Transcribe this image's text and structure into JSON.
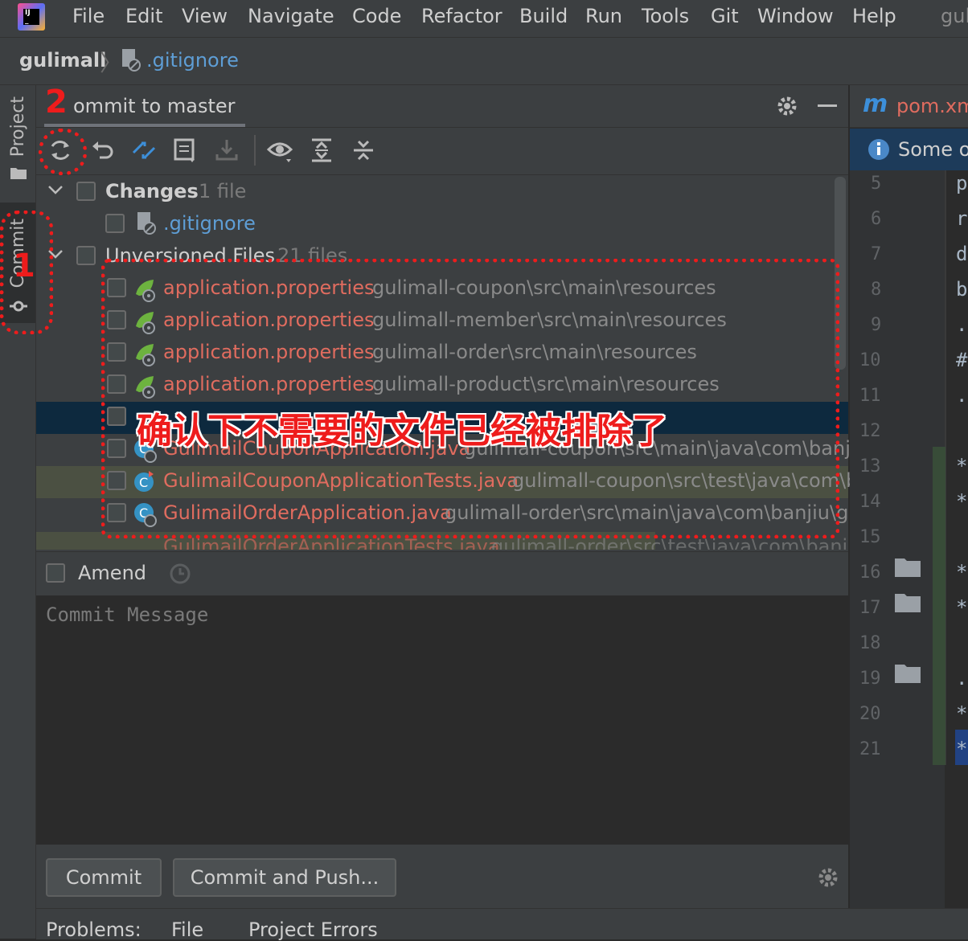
{
  "menu": {
    "items": [
      "File",
      "Edit",
      "View",
      "Navigate",
      "Code",
      "Refactor",
      "Build",
      "Run",
      "Tools",
      "Git",
      "Window",
      "Help"
    ],
    "project_short": "gul"
  },
  "breadcrumb": {
    "project": "gulimall",
    "file": ".gitignore"
  },
  "sidebar": {
    "project_tab": "Project",
    "commit_tab": "Commit"
  },
  "commit_panel": {
    "title": "ommit to master",
    "changes_group": {
      "label": "Changes",
      "count": "1 file"
    },
    "changed_file": ".gitignore",
    "unversioned_group": {
      "label": "Unversioned Files",
      "count": "21 files"
    },
    "files": [
      {
        "name": "application.properties",
        "path": "gulimall-coupon\\src\\main\\resources"
      },
      {
        "name": "application.properties",
        "path": "gulimall-member\\src\\main\\resources"
      },
      {
        "name": "application.properties",
        "path": "gulimall-order\\src\\main\\resources"
      },
      {
        "name": "application.properties",
        "path": "gulimall-product\\src\\main\\resources"
      },
      {
        "name": "",
        "path": ""
      },
      {
        "name": "GulimailCouponApplication.java",
        "path": "gulimall-coupon\\src\\main\\java\\com\\banjiu"
      },
      {
        "name": "GulimailCouponApplicationTests.java",
        "path": "gulimall-coupon\\src\\test\\java\\com\\b"
      },
      {
        "name": "GulimailOrderApplication.java",
        "path": "gulimall-order\\src\\main\\java\\com\\banjiu\\gu"
      },
      {
        "name": "GulimailOrderApplicationTests.java",
        "path": "gulimall-order\\src\\test\\java\\com\\banjiu"
      }
    ],
    "amend_label": "Amend",
    "commit_message_placeholder": "Commit Message",
    "commit_button": "Commit",
    "commit_push_button": "Commit and Push..."
  },
  "editor": {
    "tab": "pom.xm",
    "notification": "Some o",
    "line_numbers": [
      "5",
      "6",
      "7",
      "8",
      "9",
      "10",
      "11",
      "12",
      "13",
      "14",
      "15",
      "16",
      "17",
      "18",
      "19",
      "20",
      "21"
    ],
    "code_chars": [
      "p",
      "r",
      "d",
      "b",
      ".",
      "#",
      ".",
      "",
      "*",
      "*",
      "",
      "*",
      "*",
      "",
      ".",
      "*",
      "*"
    ]
  },
  "bottom": {
    "items": [
      "Problems:",
      "File",
      "Project Errors"
    ]
  },
  "annotations": {
    "num1": "1",
    "num2": "2",
    "text": "确认下不需要的文件已经被排除了"
  },
  "colors": {
    "annotation": "#ee1c1c",
    "file_unversioned": "#e06c5f",
    "accent": "#4a88c7"
  }
}
